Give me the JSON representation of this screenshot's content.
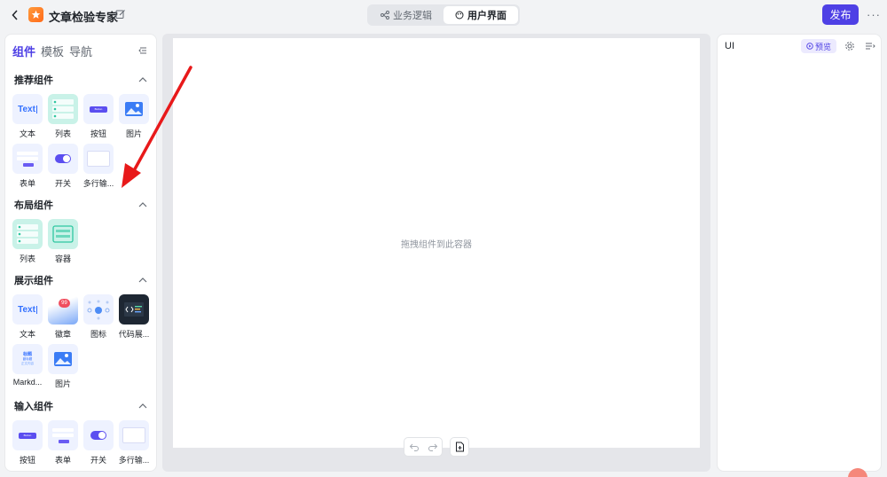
{
  "header": {
    "title": "文章检验专家",
    "tabs": [
      {
        "label": "业务逻辑",
        "icon": "flow-icon"
      },
      {
        "label": "用户界面",
        "icon": "palette-icon"
      }
    ],
    "publish_label": "发布",
    "more_label": "···"
  },
  "left_panel": {
    "tabs": [
      "组件",
      "模板",
      "导航"
    ],
    "sections": {
      "recommended": {
        "title": "推荐组件",
        "items": [
          "文本",
          "列表",
          "按钮",
          "图片",
          "表单",
          "开关",
          "多行输..."
        ]
      },
      "layout": {
        "title": "布局组件",
        "items": [
          "列表",
          "容器"
        ]
      },
      "display": {
        "title": "展示组件",
        "items": [
          "文本",
          "徽章",
          "图标",
          "代码展...",
          "Markd...",
          "图片"
        ]
      },
      "input": {
        "title": "输入组件",
        "items": [
          "按钮",
          "表单",
          "开关",
          "多行输..."
        ]
      }
    },
    "thumb_text": {
      "text": "Text",
      "badge": "99",
      "button": "Button",
      "markdown_lines": [
        "标题",
        "副标题",
        "正文内容"
      ]
    }
  },
  "canvas": {
    "drop_hint": "拖拽组件到此容器"
  },
  "right_panel": {
    "title": "UI",
    "preview_label": "预览"
  },
  "colors": {
    "accent": "#4e40e5",
    "annotation_arrow": "#e8191a"
  }
}
